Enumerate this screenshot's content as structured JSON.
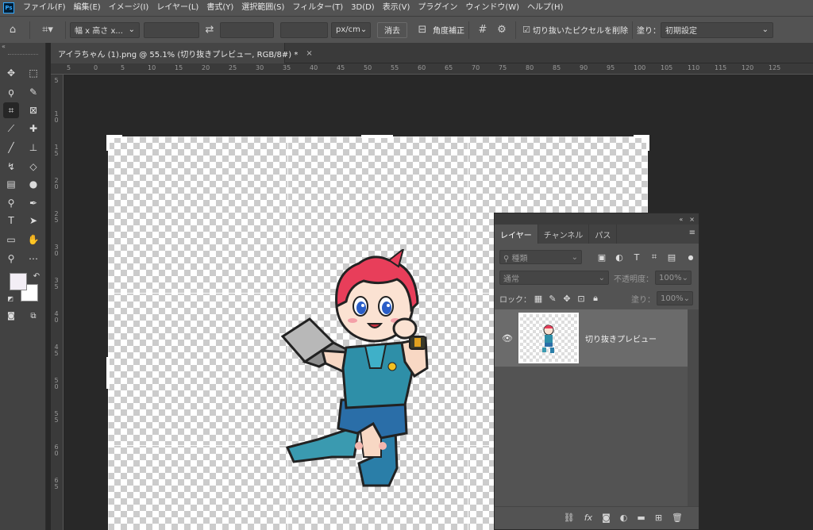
{
  "app": {
    "logo": "Ps"
  },
  "menu": [
    "ファイル(F)",
    "編集(E)",
    "イメージ(I)",
    "レイヤー(L)",
    "書式(Y)",
    "選択範囲(S)",
    "フィルター(T)",
    "3D(D)",
    "表示(V)",
    "プラグイン",
    "ウィンドウ(W)",
    "ヘルプ(H)"
  ],
  "options": {
    "ratio_select": "幅 x 高さ x...",
    "width_value": "",
    "height_value": "",
    "resolution_value": "",
    "unit_select": "px/cm",
    "clear_button": "消去",
    "straighten_label": "角度補正",
    "delete_cropped_label": "切り抜いたピクセルを削除",
    "delete_cropped_checked": true,
    "fill_label": "塗り：",
    "fill_select": "初期設定"
  },
  "document": {
    "tab_title": "アイラちゃん (1).png @ 55.1% (切り抜きプレビュー, RGB/8#) *",
    "close_glyph": "×"
  },
  "rulers": {
    "top": [
      "5",
      "0",
      "5",
      "10",
      "15",
      "20",
      "25",
      "30",
      "35",
      "40",
      "45",
      "50",
      "55",
      "60",
      "65",
      "70",
      "75",
      "80",
      "85",
      "90",
      "95",
      "100",
      "105",
      "110",
      "115",
      "120",
      "125"
    ],
    "left": [
      "5",
      "1 0",
      "1 5",
      "2 0",
      "2 5",
      "3 0",
      "3 5",
      "4 0",
      "4 5",
      "5 0",
      "5 5",
      "6 0",
      "6 5"
    ]
  },
  "layers_panel": {
    "tabs": [
      "レイヤー",
      "チャンネル",
      "パス"
    ],
    "active_tab": 0,
    "filter_kind": "種類",
    "blend_mode": "通常",
    "opacity_label": "不透明度：",
    "opacity_value": "100%",
    "lock_label": "ロック：",
    "fill_label": "塗り：",
    "fill_value": "100%",
    "layers": [
      {
        "name": "切り抜きプレビュー",
        "visible": true
      }
    ]
  },
  "colors": {
    "foreground": "#f3eef5",
    "background": "#ffffff",
    "character_hair": "#e83e5a",
    "character_shirt": "#2e8fa8",
    "character_shorts": "#2a6ea8"
  }
}
